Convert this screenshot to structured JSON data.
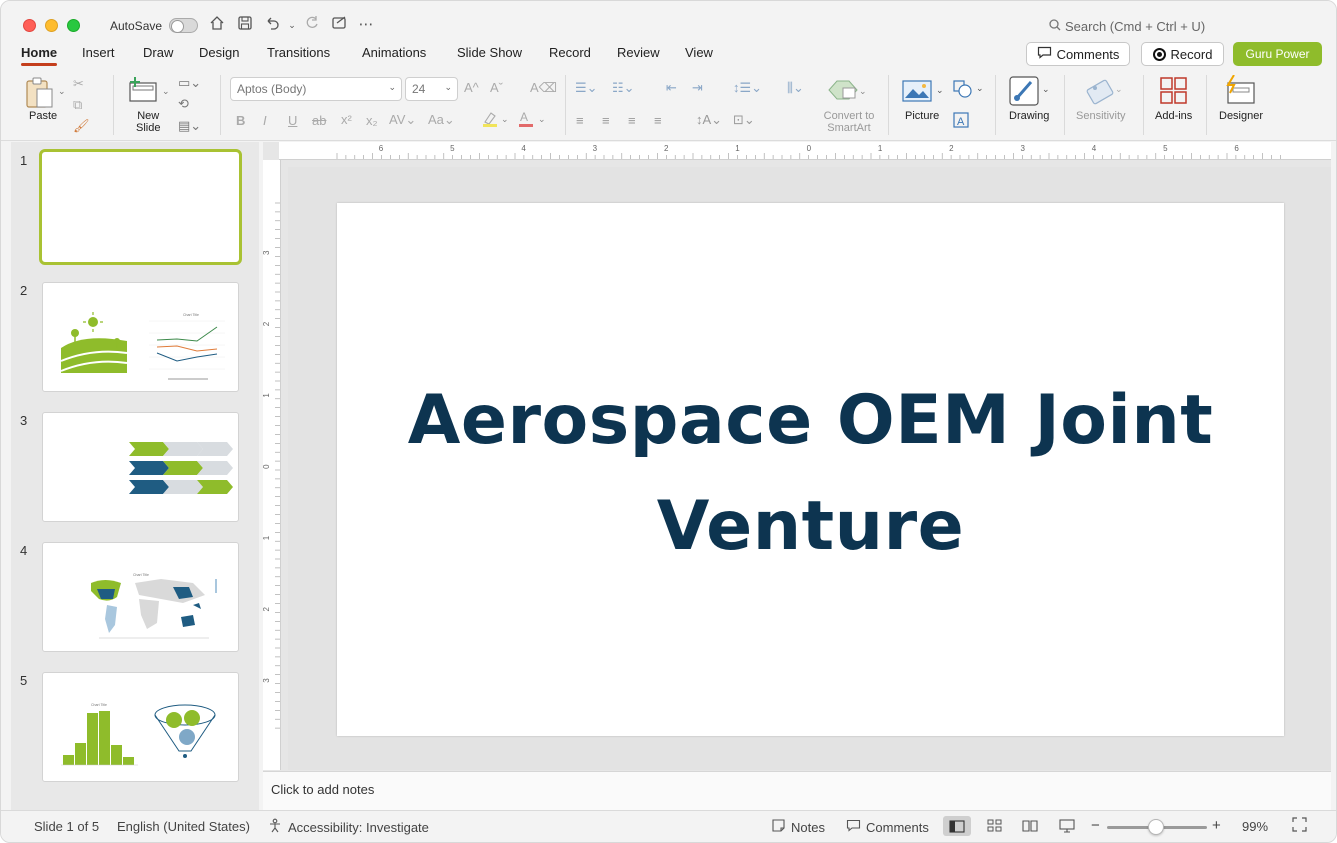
{
  "titlebar": {
    "autosave_label": "AutoSave",
    "search_placeholder": "Search (Cmd + Ctrl + U)"
  },
  "tabs": [
    {
      "label": "Home",
      "active": true
    },
    {
      "label": "Insert"
    },
    {
      "label": "Draw"
    },
    {
      "label": "Design"
    },
    {
      "label": "Transitions"
    },
    {
      "label": "Animations"
    },
    {
      "label": "Slide Show"
    },
    {
      "label": "Record"
    },
    {
      "label": "Review"
    },
    {
      "label": "View"
    }
  ],
  "header_buttons": {
    "comments": "Comments",
    "record": "Record",
    "guru": "Guru Power"
  },
  "ribbon": {
    "paste": "Paste",
    "new_slide_line1": "New",
    "new_slide_line2": "Slide",
    "font_name": "Aptos (Body)",
    "font_size": "24",
    "convert_line1": "Convert to",
    "convert_line2": "SmartArt",
    "picture": "Picture",
    "drawing": "Drawing",
    "sensitivity": "Sensitivity",
    "addins": "Add-ins",
    "designer": "Designer"
  },
  "thumbnails": [
    {
      "num": "1",
      "selected": true
    },
    {
      "num": "2"
    },
    {
      "num": "3"
    },
    {
      "num": "4"
    },
    {
      "num": "5"
    }
  ],
  "ruler": {
    "horizontal": [
      "6",
      "5",
      "4",
      "3",
      "2",
      "1",
      "0",
      "1",
      "2",
      "3",
      "4",
      "5",
      "6"
    ],
    "vertical": [
      "3",
      "2",
      "1",
      "0",
      "1",
      "2",
      "3"
    ]
  },
  "slide": {
    "title_line1": "Aerospace OEM Joint",
    "title_line2": "Venture",
    "title_color": "#0d3450"
  },
  "notes_placeholder": "Click to add notes",
  "statusbar": {
    "slide_info": "Slide 1 of 5",
    "language": "English (United States)",
    "accessibility": "Accessibility: Investigate",
    "notes": "Notes",
    "comments": "Comments",
    "zoom": "99%"
  },
  "colors": {
    "accent_green": "#8fbc2b",
    "tab_underline": "#c43e1c",
    "navy": "#0d3450",
    "teal": "#1f5c82"
  }
}
